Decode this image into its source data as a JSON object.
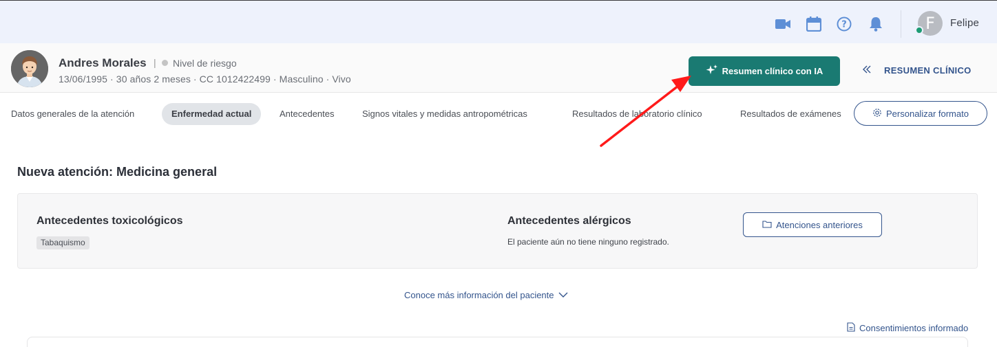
{
  "topbar": {
    "user_initial": "F",
    "user_name": "Felipe",
    "icons": [
      "video-camera-icon",
      "calendar-icon",
      "help-icon",
      "bell-icon"
    ]
  },
  "patient": {
    "name": "Andres Morales",
    "separator": "|",
    "risk_label": "Nivel de riesgo",
    "info": "13/06/1995 · 30 años 2 meses · CC 1012422499 · Masculino · Vivo"
  },
  "actions": {
    "ai_summary_label": "Resumen clínico con IA",
    "summary_link_label": "RESUMEN CLÍNICO"
  },
  "tabs": [
    {
      "label": "Datos generales de la atención"
    },
    {
      "label": "Enfermedad actual"
    },
    {
      "label": "Antecedentes"
    },
    {
      "label": "Signos vitales y medidas antropométricas"
    },
    {
      "label": "Resultados de laboratorio clínico"
    },
    {
      "label": "Resultados de exámenes"
    }
  ],
  "custom_format_label": "Personalizar formato",
  "main": {
    "title": "Nueva atención: Medicina general",
    "toxic_title": "Antecedentes toxicológicos",
    "toxic_chip": "Tabaquismo",
    "allergy_title": "Antecedentes alérgicos",
    "allergy_empty": "El paciente aún no tiene ninguno registrado.",
    "previous_visits_label": "Atenciones anteriores",
    "more_info_label": "Conoce más información del paciente",
    "consent_label": "Consentimientos informado"
  },
  "colors": {
    "accent": "#1a7a72",
    "link": "#33548c",
    "topbar_bg": "#eef2fc",
    "online": "#1d9c74",
    "annotation_arrow": "#ff1a1a"
  }
}
